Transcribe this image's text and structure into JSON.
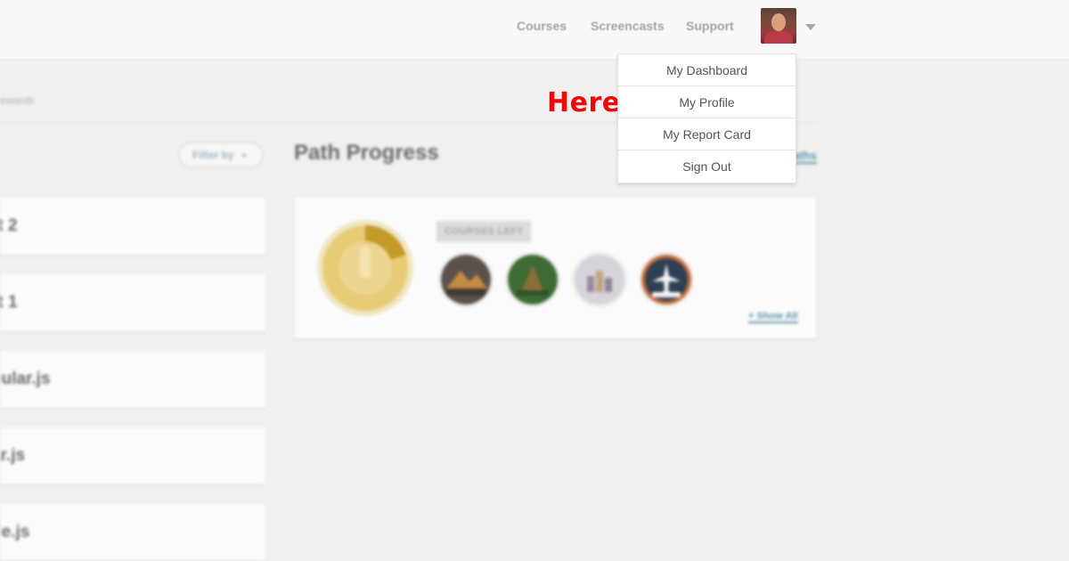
{
  "nav": {
    "courses": "Courses",
    "screencasts": "Screencasts",
    "support": "Support"
  },
  "user_menu": {
    "items": [
      "My Dashboard",
      "My Profile",
      "My Report Card",
      "Sign Out"
    ]
  },
  "annotation": "Here >>",
  "breadcrumb": "ewards",
  "filter": {
    "label": "Filter by"
  },
  "course_list": [
    {
      "title": "rt 2"
    },
    {
      "title": "rt 1"
    },
    {
      "title": "gular.js"
    },
    {
      "title": "ar.js"
    },
    {
      "title": "de.js"
    }
  ],
  "path_progress": {
    "title": "Path Progress",
    "paths_link": "aths",
    "courses_left_label": "COURSES LEFT",
    "show_all": "+ Show All",
    "progress_fraction": 0.2,
    "badge_colors": [
      "#e8cb75",
      "#c39a28"
    ]
  },
  "icons": [
    "user-avatar",
    "chevron-down-icon",
    "path-badge",
    "course-badge-mountains",
    "course-badge-forest",
    "course-badge-city",
    "course-badge-jquery-plane"
  ]
}
